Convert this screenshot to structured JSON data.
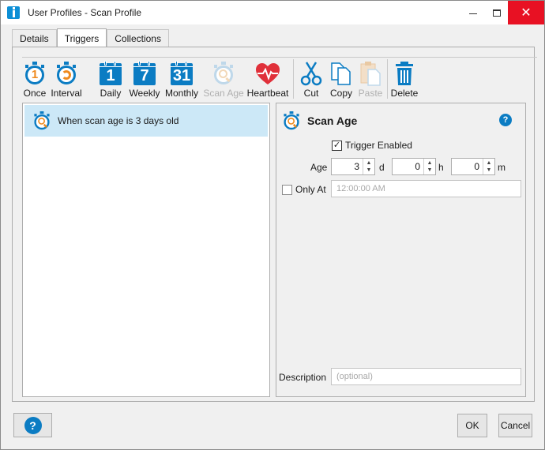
{
  "window": {
    "title": "User Profiles - Scan Profile"
  },
  "tabs": [
    {
      "label": "Details"
    },
    {
      "label": "Triggers",
      "active": true
    },
    {
      "label": "Collections"
    }
  ],
  "toolbar": {
    "items": [
      {
        "label": "Once",
        "icon": "stopwatch-once-icon"
      },
      {
        "label": "Interval",
        "icon": "stopwatch-interval-icon"
      },
      {
        "label": "Daily",
        "icon": "calendar-daily-icon",
        "glyph": "1"
      },
      {
        "label": "Weekly",
        "icon": "calendar-weekly-icon",
        "glyph": "7"
      },
      {
        "label": "Monthly",
        "icon": "calendar-monthly-icon",
        "glyph": "31"
      },
      {
        "label": "Scan Age",
        "icon": "stopwatch-scan-age-icon",
        "disabled": true
      },
      {
        "label": "Heartbeat",
        "icon": "heartbeat-icon"
      },
      {
        "label": "Cut",
        "icon": "scissors-icon"
      },
      {
        "label": "Copy",
        "icon": "copy-icon"
      },
      {
        "label": "Paste",
        "icon": "paste-icon",
        "disabled": true
      },
      {
        "label": "Delete",
        "icon": "trash-icon"
      }
    ]
  },
  "triggers": [
    {
      "text": "When scan age is 3 days old",
      "selected": true
    }
  ],
  "detail": {
    "title": "Scan Age",
    "trigger_enabled_label": "Trigger Enabled",
    "trigger_enabled": true,
    "age_label": "Age",
    "days_value": "3",
    "days_unit": "d",
    "hours_value": "0",
    "hours_unit": "h",
    "minutes_value": "0",
    "minutes_unit": "m",
    "only_at_label": "Only At",
    "only_at_checked": false,
    "only_at_value": "12:00:00 AM",
    "description_label": "Description",
    "description_placeholder": "(optional)"
  },
  "footer": {
    "help_glyph": "?",
    "ok_label": "OK",
    "cancel_label": "Cancel"
  },
  "colors": {
    "accent": "#0b7cc3",
    "stopwatch_inner": "#ef8a1d",
    "heart": "#e0303a",
    "selection": "#cce8f7",
    "close_button": "#e81123"
  }
}
